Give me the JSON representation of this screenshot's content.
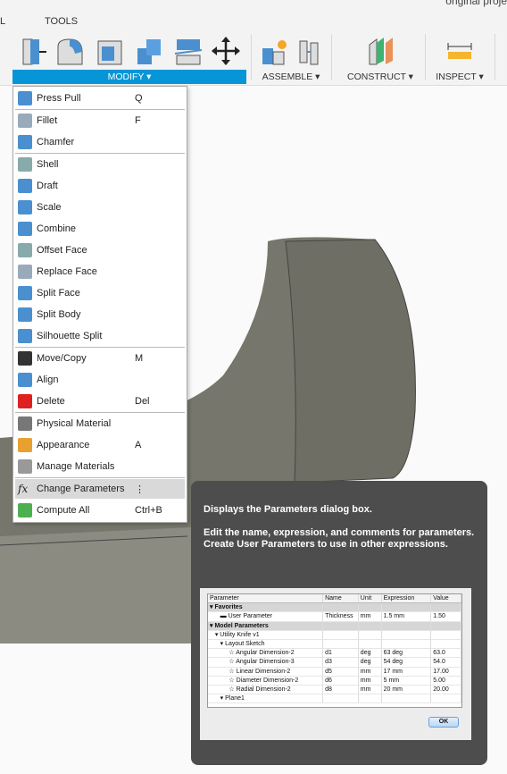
{
  "topbar": {
    "tab_partial": "L",
    "tab_tools": "TOOLS",
    "project": "original proje"
  },
  "groups": {
    "modify": "MODIFY ▾",
    "assemble": "ASSEMBLE ▾",
    "construct": "CONSTRUCT ▾",
    "inspect": "INSPECT ▾"
  },
  "accent": "#0696d7",
  "menu": {
    "items": [
      {
        "label": "Press Pull",
        "shortcut": "Q",
        "icon": "press-pull-icon"
      },
      {
        "label": "Fillet",
        "shortcut": "F",
        "icon": "fillet-icon"
      },
      {
        "label": "Chamfer",
        "shortcut": "",
        "icon": "chamfer-icon"
      },
      {
        "label": "Shell",
        "shortcut": "",
        "icon": "shell-icon"
      },
      {
        "label": "Draft",
        "shortcut": "",
        "icon": "draft-icon"
      },
      {
        "label": "Scale",
        "shortcut": "",
        "icon": "scale-icon"
      },
      {
        "label": "Combine",
        "shortcut": "",
        "icon": "combine-icon"
      },
      {
        "label": "Offset Face",
        "shortcut": "",
        "icon": "offset-face-icon"
      },
      {
        "label": "Replace Face",
        "shortcut": "",
        "icon": "replace-face-icon"
      },
      {
        "label": "Split Face",
        "shortcut": "",
        "icon": "split-face-icon"
      },
      {
        "label": "Split Body",
        "shortcut": "",
        "icon": "split-body-icon"
      },
      {
        "label": "Silhouette Split",
        "shortcut": "",
        "icon": "silhouette-split-icon"
      },
      {
        "label": "Move/Copy",
        "shortcut": "M",
        "icon": "move-icon"
      },
      {
        "label": "Align",
        "shortcut": "",
        "icon": "align-icon"
      },
      {
        "label": "Delete",
        "shortcut": "Del",
        "icon": "delete-icon"
      },
      {
        "label": "Physical Material",
        "shortcut": "",
        "icon": "physical-material-icon"
      },
      {
        "label": "Appearance",
        "shortcut": "A",
        "icon": "appearance-icon"
      },
      {
        "label": "Manage Materials",
        "shortcut": "",
        "icon": "manage-materials-icon"
      },
      {
        "label": "Change Parameters",
        "shortcut": "⋮",
        "icon": "fx-icon"
      },
      {
        "label": "Compute All",
        "shortcut": "Ctrl+B",
        "icon": "compute-all-icon"
      }
    ]
  },
  "tooltip": {
    "title": "Displays the Parameters dialog box.",
    "body": "Edit the name, expression, and comments for parameters. Create User Parameters to use in other expressions.",
    "table": {
      "headers": [
        "Parameter",
        "Name",
        "Unit",
        "Expression",
        "Value"
      ],
      "rows": [
        {
          "cells": [
            "▾ Favorites",
            "",
            "",
            "",
            ""
          ],
          "group": true
        },
        {
          "cells": [
            "      ▬ User Parameter",
            "Thickness",
            "mm",
            "1.5 mm",
            "1.50"
          ]
        },
        {
          "cells": [
            "▾ Model Parameters",
            "",
            "",
            "",
            ""
          ],
          "group": true
        },
        {
          "cells": [
            "   ▾ Utility Knife v1",
            "",
            "",
            "",
            ""
          ]
        },
        {
          "cells": [
            "      ▾ Layout Sketch",
            "",
            "",
            "",
            ""
          ]
        },
        {
          "cells": [
            "           ☆ Angular Dimension-2",
            "d1",
            "deg",
            "63 deg",
            "63.0"
          ]
        },
        {
          "cells": [
            "           ☆ Angular Dimension-3",
            "d3",
            "deg",
            "54 deg",
            "54.0"
          ]
        },
        {
          "cells": [
            "           ☆ Linear Dimension-2",
            "d5",
            "mm",
            "17 mm",
            "17.00"
          ]
        },
        {
          "cells": [
            "           ☆ Diameter Dimension-2",
            "d6",
            "mm",
            "5 mm",
            "5.00"
          ]
        },
        {
          "cells": [
            "           ☆ Radial Dimension-2",
            "d8",
            "mm",
            "20 mm",
            "20.00"
          ]
        },
        {
          "cells": [
            "      ▾ Plane1",
            "",
            "",
            "",
            ""
          ]
        }
      ],
      "ok": "OK"
    }
  }
}
